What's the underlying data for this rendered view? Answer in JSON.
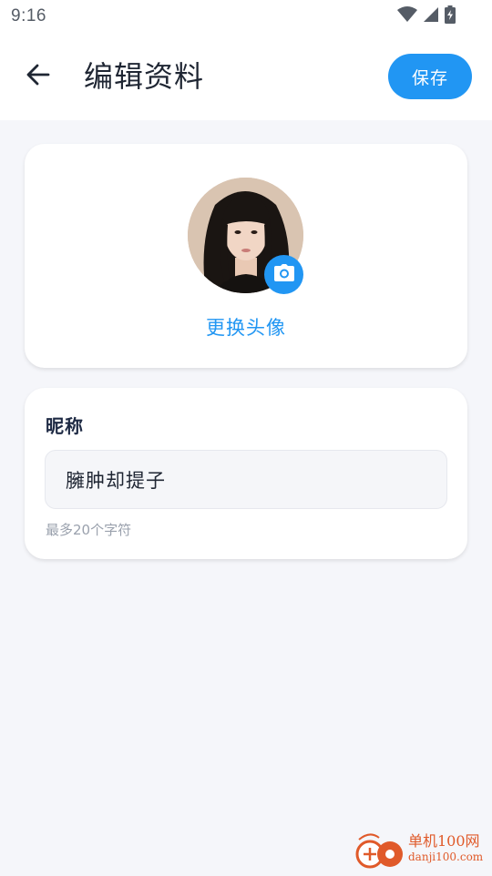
{
  "status_bar": {
    "time": "9:16",
    "icons": [
      "wifi-icon",
      "signal-icon",
      "battery-charging-icon"
    ]
  },
  "header": {
    "back_icon": "arrow-left-icon",
    "title": "编辑资料",
    "save_label": "保存"
  },
  "avatar_section": {
    "camera_icon": "camera-icon",
    "change_label": "更换头像"
  },
  "nickname": {
    "label": "昵称",
    "value": "臃肿却提子",
    "hint": "最多20个字符"
  },
  "watermark": {
    "name": "单机100网",
    "url": "danji100.com"
  },
  "colors": {
    "accent": "#2196f3",
    "background": "#f5f6fa",
    "card": "#ffffff",
    "watermark": "#e05a2a"
  }
}
